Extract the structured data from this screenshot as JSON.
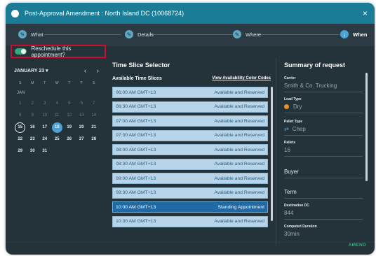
{
  "window": {
    "title": "Post-Approval Amendment : North Island DC (10068724)",
    "close": "×"
  },
  "steps": [
    {
      "label": "What",
      "icon": "pencil-icon"
    },
    {
      "label": "Details",
      "icon": "pencil-icon"
    },
    {
      "label": "Where",
      "icon": "pencil-icon"
    },
    {
      "label": "When",
      "icon": "arrow-down-icon"
    }
  ],
  "reschedule": {
    "label": "Reschedule this appointment?",
    "on": true
  },
  "calendar": {
    "month_label": "JANUARY 23 ▾",
    "prev": "‹",
    "next": "›",
    "dow": [
      "S",
      "M",
      "T",
      "W",
      "T",
      "F",
      "S"
    ],
    "month_name": "JAN",
    "weeks": [
      [
        "1",
        "2",
        "3",
        "4",
        "5",
        "6",
        "7"
      ],
      [
        "8",
        "9",
        "10",
        "11",
        "12",
        "13",
        "14"
      ],
      [
        "15",
        "16",
        "17",
        "18",
        "19",
        "20",
        "21"
      ],
      [
        "22",
        "23",
        "24",
        "25",
        "26",
        "27",
        "28"
      ],
      [
        "29",
        "30",
        "31",
        "",
        "",
        "",
        ""
      ]
    ],
    "today": "15",
    "selected": "18"
  },
  "slices": {
    "title": "Time Slice Selector",
    "available_label": "Available Time Slices",
    "legend_link": "View Availability Color Codes",
    "items": [
      {
        "time": "06:00 AM GMT+13",
        "status": "Available and Reserved"
      },
      {
        "time": "06:30 AM GMT+13",
        "status": "Available and Reserved"
      },
      {
        "time": "07:00 AM GMT+13",
        "status": "Available and Reserved"
      },
      {
        "time": "07:30 AM GMT+13",
        "status": "Available and Reserved"
      },
      {
        "time": "08:00 AM GMT+13",
        "status": "Available and Reserved"
      },
      {
        "time": "08:30 AM GMT+13",
        "status": "Available and Reserved"
      },
      {
        "time": "09:00 AM GMT+13",
        "status": "Available and Reserved"
      },
      {
        "time": "09:30 AM GMT+13",
        "status": "Available and Reserved"
      },
      {
        "time": "10:00 AM GMT+13",
        "status": "Standing Appointment",
        "selected": true
      },
      {
        "time": "10:30 AM GMT+13",
        "status": "Available and Reserved"
      }
    ]
  },
  "summary": {
    "title": "Summary of request",
    "carrier_label": "Carrier",
    "carrier": "Smith & Co. Trucking",
    "load_label": "Load Type",
    "load": "Dry",
    "pallet_label": "Pallet Type",
    "pallet": "Chep",
    "pallets_label": "Pallets",
    "pallets": "16",
    "buyer": "Buyer",
    "term": "Term",
    "dest_label": "Destination DC",
    "dest": "844",
    "duration_label": "Computed Duration",
    "duration": "30min"
  },
  "footer": {
    "amend": "AMEND"
  },
  "colors": {
    "titlebar": "#1b7c98",
    "panel": "#243239",
    "slot": "#b7d4e8",
    "slot_selected": "#1f6aa5",
    "toggle": "#2faa7a",
    "highlight_border": "#c8102e"
  }
}
